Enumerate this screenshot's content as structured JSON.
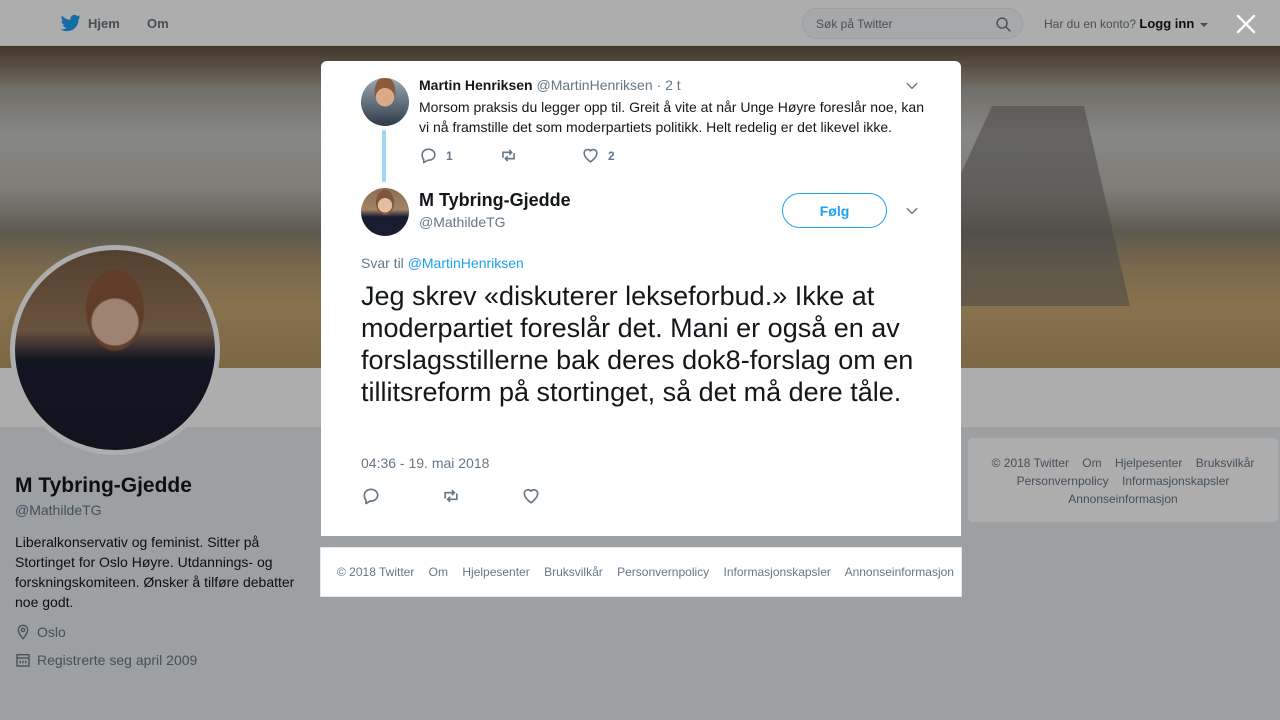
{
  "topbar": {
    "home_label": "Hjem",
    "about_label": "Om",
    "search_placeholder": "Søk på Twitter",
    "account_prompt": "Har du en konto?",
    "login_label": "Logg inn"
  },
  "colors": {
    "accent": "#1da1f2",
    "thread_line": "#a2d7f2",
    "muted_text": "#657786"
  },
  "profile": {
    "name": "M Tybring-Gjedde",
    "handle": "@MathildeTG",
    "bio": "Liberalkonservativ og feminist. Sitter på Stortinget for Oslo Høyre. Utdannings- og forskningskomiteen. Ønsker å tilføre debatter noe godt.",
    "location": "Oslo",
    "joined": "Registrerte seg april 2009"
  },
  "side_footer": {
    "links": [
      "© 2018 Twitter",
      "Om",
      "Hjelpesenter",
      "Bruksvilkår",
      "Personvernpolicy",
      "Informasjonskapsler",
      "Annonseinformasjon"
    ]
  },
  "parent_tweet": {
    "author_name": "Martin Henriksen",
    "author_handle": "@MartinHenriksen",
    "time": "· 2 t",
    "text": "Morsom praksis du legger opp til. Greit å vite at når Unge Høyre foreslår noe, kan vi nå framstille det som moderpartiets politikk. Helt redelig er det likevel ikke.",
    "reply_count": "1",
    "like_count": "2"
  },
  "main_tweet": {
    "author_name": "M Tybring-Gjedde",
    "author_handle": "@MathildeTG",
    "follow_label": "Følg",
    "reply_prefix": "Svar til",
    "reply_to": "@MartinHenriksen",
    "text": "Jeg skrev «diskuterer lekseforbud.» Ikke at moderpartiet foreslår det. Mani er også en av forslagsstillerne bak deres dok8-forslag om en tillitsreform på stortinget, så det må dere tåle.",
    "timestamp": "04:36 - 19. mai 2018"
  },
  "modal_footer": {
    "links": [
      "© 2018 Twitter",
      "Om",
      "Hjelpesenter",
      "Bruksvilkår",
      "Personvernpolicy",
      "Informasjonskapsler",
      "Annonseinformasjon"
    ]
  }
}
